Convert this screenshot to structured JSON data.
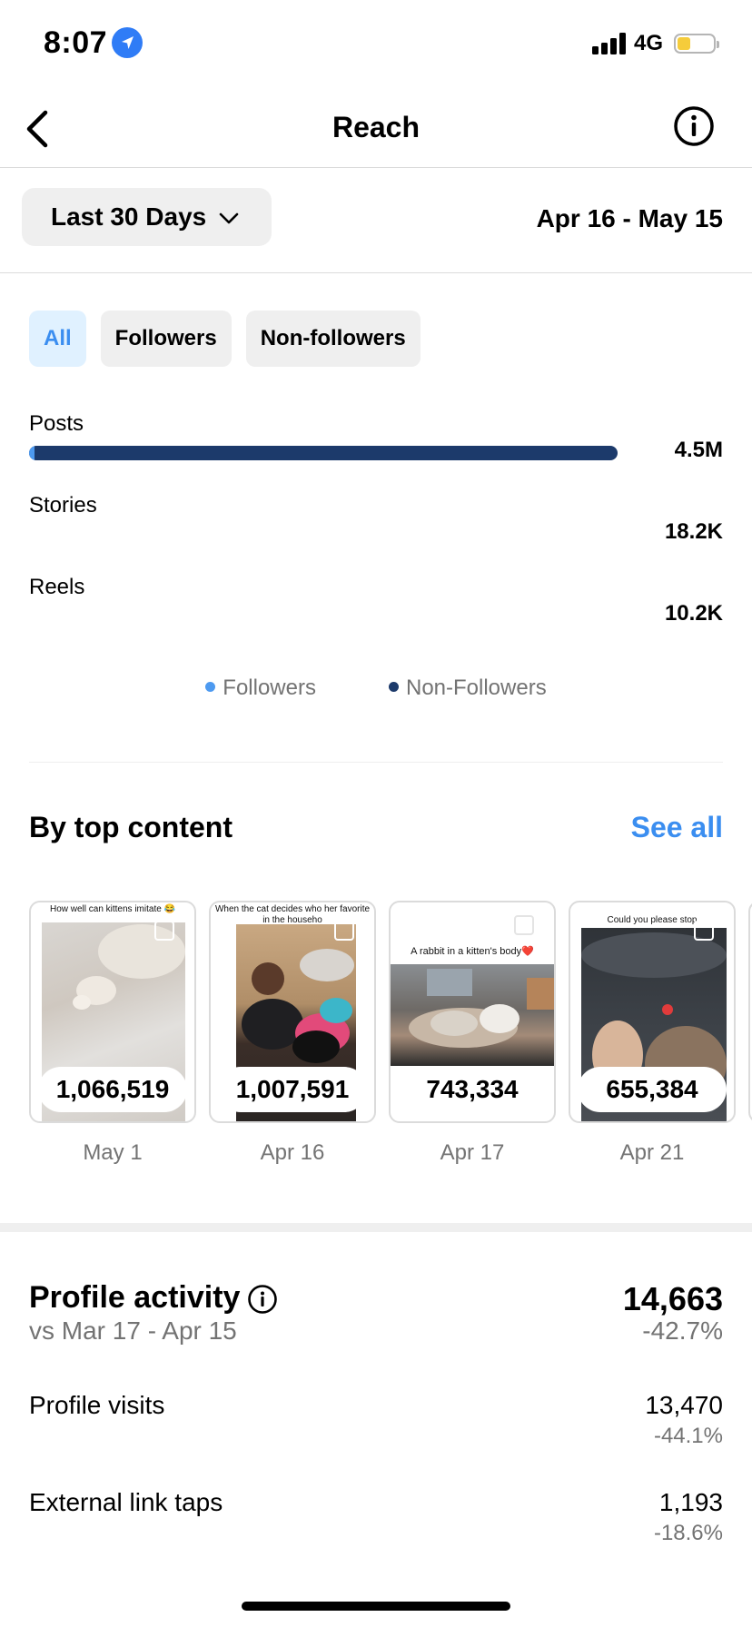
{
  "status_bar": {
    "time": "8:07",
    "network": "4G"
  },
  "nav": {
    "title": "Reach"
  },
  "date_filter": {
    "selected": "Last 30 Days",
    "range": "Apr 16 - May 15"
  },
  "audience_tabs": [
    {
      "label": "All",
      "active": true
    },
    {
      "label": "Followers",
      "active": false
    },
    {
      "label": "Non-followers",
      "active": false
    }
  ],
  "breakdown": {
    "posts": {
      "label": "Posts",
      "value": "4.5M"
    },
    "stories": {
      "label": "Stories",
      "value": "18.2K"
    },
    "reels": {
      "label": "Reels",
      "value": "10.2K"
    }
  },
  "legend": {
    "followers": "Followers",
    "non_followers": "Non-Followers"
  },
  "colors": {
    "followers": "#4d9af0",
    "non_followers": "#1c3a6b",
    "accent": "#3b8ef0"
  },
  "top_content": {
    "title": "By top content",
    "see_all": "See all",
    "items": [
      {
        "caption": "How well can kittens imitate 😂",
        "count": "1,066,519",
        "date": "May 1"
      },
      {
        "caption": "When the cat decides who her favorite in the househo",
        "count": "1,007,591",
        "date": "Apr 16"
      },
      {
        "caption": "A rabbit in a kitten's body❤️",
        "count": "743,334",
        "date": "Apr 17"
      },
      {
        "caption": "Could you please stop",
        "count": "655,384",
        "date": "Apr 21"
      }
    ]
  },
  "profile_activity": {
    "title": "Profile activity",
    "comparison": "vs Mar 17 - Apr 15",
    "total": "14,663",
    "total_change": "-42.7%",
    "rows": [
      {
        "label": "Profile visits",
        "value": "13,470",
        "change": "-44.1%"
      },
      {
        "label": "External link taps",
        "value": "1,193",
        "change": "-18.6%"
      }
    ]
  }
}
